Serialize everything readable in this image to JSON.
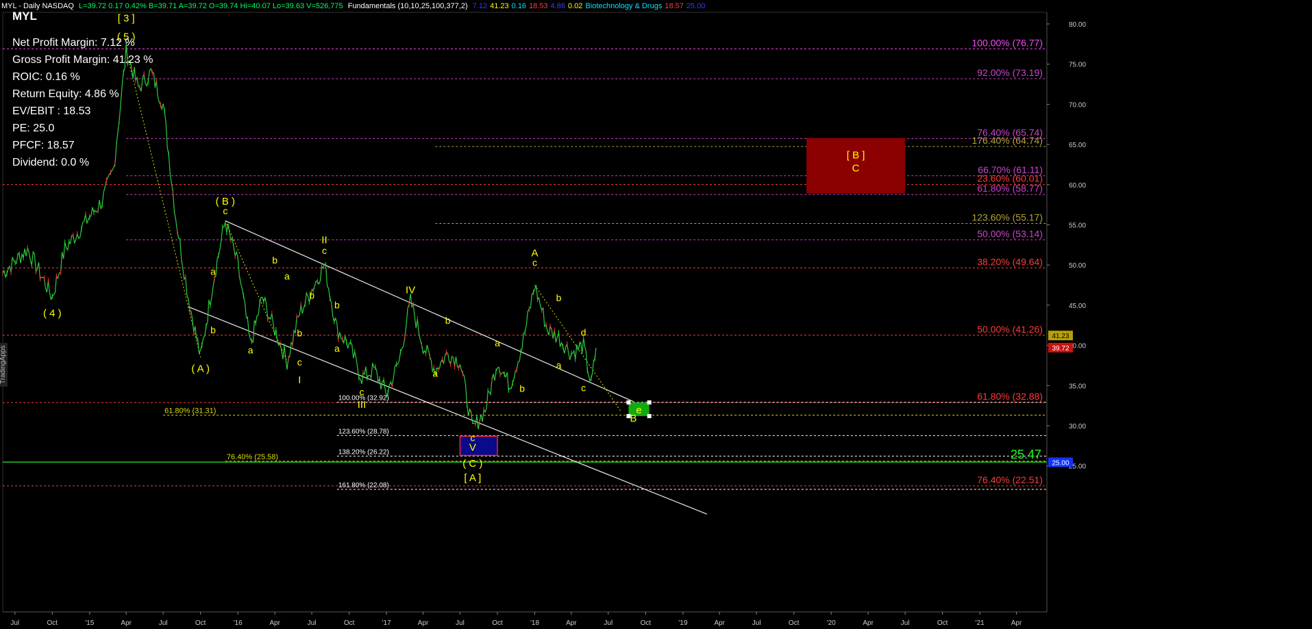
{
  "header": {
    "title": "MYL - Daily NASDAQ",
    "stats": "L=39.72  0.17  0.42%  B=39.71  A=39.72  O=39.74  Hi=40.07  Lo=39.63  V=526,775",
    "indicator": "Fundamentals (10,10,25,100,377,2)",
    "ind_values": [
      {
        "text": "7.12",
        "color": "#3a3aff"
      },
      {
        "text": "41.23",
        "color": "#ffff00"
      },
      {
        "text": "0.16",
        "color": "#00e5ff"
      },
      {
        "text": "18.53",
        "color": "#ff3b3b"
      },
      {
        "text": "4.86",
        "color": "#3a3aff"
      },
      {
        "text": "0.02",
        "color": "#ffff00"
      },
      {
        "text": "Biotechnology & Drugs",
        "color": "#00e5ff"
      },
      {
        "text": "18.57",
        "color": "#ff3b3b"
      },
      {
        "text": "25.00",
        "color": "#3a3aff"
      }
    ]
  },
  "ticker": "MYL",
  "fundamentals": [
    "Net Profit Margin: 7.12 %",
    "Gross Profit Margin: 41.23 %",
    "ROIC: 0.16 %",
    "Return Equity: 4.86 %",
    "EV/EBIT : 18.53",
    "PE: 25.0",
    "PFCF: 18.57",
    "Dividend: 0.0 %"
  ],
  "side_tag": "TradingApps",
  "chart_data": {
    "type": "line",
    "title": "MYL - Daily",
    "ylim": [
      19,
      82
    ],
    "y_ticks": [
      25,
      30,
      35,
      40,
      45,
      50,
      55,
      60,
      65,
      70,
      75,
      80
    ],
    "x_labels": [
      "Jul",
      "Oct",
      "'15",
      "Apr",
      "Jul",
      "Oct",
      "'16",
      "Apr",
      "Jul",
      "Oct",
      "'17",
      "Apr",
      "Jul",
      "Oct",
      "'18",
      "Apr",
      "Jul",
      "Oct",
      "'19",
      "Apr",
      "Jul",
      "Oct",
      "'20",
      "Apr",
      "Jul",
      "Oct",
      "'21",
      "Apr"
    ],
    "price_path": [
      {
        "date": "2014-06",
        "price": 49
      },
      {
        "date": "2014-08",
        "price": 52
      },
      {
        "date": "2014-09",
        "price": 49
      },
      {
        "date": "2014-10",
        "price": 46
      },
      {
        "date": "2014-11",
        "price": 52
      },
      {
        "date": "2015-01",
        "price": 56
      },
      {
        "date": "2015-02",
        "price": 58
      },
      {
        "date": "2015-03",
        "price": 62
      },
      {
        "date": "2015-04",
        "price": 76.7
      },
      {
        "date": "2015-05",
        "price": 72
      },
      {
        "date": "2015-06",
        "price": 74
      },
      {
        "date": "2015-07",
        "price": 70
      },
      {
        "date": "2015-08",
        "price": 56
      },
      {
        "date": "2015-09",
        "price": 46
      },
      {
        "date": "2015-10",
        "price": 38.5
      },
      {
        "date": "2015-11",
        "price": 48
      },
      {
        "date": "2015-12",
        "price": 55.5
      },
      {
        "date": "2016-01",
        "price": 50
      },
      {
        "date": "2016-02",
        "price": 40
      },
      {
        "date": "2016-03",
        "price": 46
      },
      {
        "date": "2016-05",
        "price": 38
      },
      {
        "date": "2016-06",
        "price": 44
      },
      {
        "date": "2016-08",
        "price": 50
      },
      {
        "date": "2016-09",
        "price": 42
      },
      {
        "date": "2016-10",
        "price": 40
      },
      {
        "date": "2016-11",
        "price": 36
      },
      {
        "date": "2016-12",
        "price": 37
      },
      {
        "date": "2017-01",
        "price": 34
      },
      {
        "date": "2017-02",
        "price": 38
      },
      {
        "date": "2017-03",
        "price": 45.5
      },
      {
        "date": "2017-04",
        "price": 40
      },
      {
        "date": "2017-05",
        "price": 37
      },
      {
        "date": "2017-06",
        "price": 39
      },
      {
        "date": "2017-07",
        "price": 38
      },
      {
        "date": "2017-08",
        "price": 29.5
      },
      {
        "date": "2017-09",
        "price": 32
      },
      {
        "date": "2017-10",
        "price": 38
      },
      {
        "date": "2017-11",
        "price": 35
      },
      {
        "date": "2017-12",
        "price": 40
      },
      {
        "date": "2018-01",
        "price": 47.5
      },
      {
        "date": "2018-02",
        "price": 42
      },
      {
        "date": "2018-03",
        "price": 41
      },
      {
        "date": "2018-04",
        "price": 39
      },
      {
        "date": "2018-05",
        "price": 40
      },
      {
        "date": "2018-05-20",
        "price": 35
      },
      {
        "date": "2018-06",
        "price": 39.7
      }
    ],
    "price_levels": [
      {
        "label": "100.00% (76.77)",
        "value": 76.9,
        "color": "#ff44ff",
        "style": "dash",
        "from": "2014-06"
      },
      {
        "label": "92.00% (73.19)",
        "value": 73.19,
        "color": "#cc44cc",
        "style": "dash",
        "from": "2015-04"
      },
      {
        "label": "76.40% (65.74)",
        "value": 65.74,
        "color": "#cc44cc",
        "style": "dash",
        "from": "2015-04"
      },
      {
        "label": "176.40% (64.74)",
        "value": 64.74,
        "color": "#b5a43a",
        "style": "dash",
        "from": "2017-05"
      },
      {
        "label": "66.70% (61.11)",
        "value": 61.11,
        "color": "#cc44cc",
        "style": "dash",
        "from": "2015-04"
      },
      {
        "label": "23.60% (60.01)",
        "value": 60.01,
        "color": "#ff3b3b",
        "style": "dash",
        "from": "2014-06"
      },
      {
        "label": "61.80% (58.77)",
        "value": 58.77,
        "color": "#cc44cc",
        "style": "dash",
        "from": "2015-04"
      },
      {
        "label": "123.60% (55.17)",
        "value": 55.17,
        "color": "#b5a43a",
        "style": "dash",
        "from": "2017-05"
      },
      {
        "label": "50.00% (53.14)",
        "value": 53.14,
        "color": "#cc44cc",
        "style": "dash",
        "from": "2015-04"
      },
      {
        "label": "38.20% (49.64)",
        "value": 49.64,
        "color": "#ff3b3b",
        "style": "dash",
        "from": "2014-06"
      },
      {
        "label": "50.00% (41.26)",
        "value": 41.26,
        "color": "#ff3b3b",
        "style": "dash",
        "from": "2014-06"
      },
      {
        "label": "61.80% (32.88)",
        "value": 32.88,
        "color": "#ff3b3b",
        "style": "dash",
        "from": "2014-06"
      },
      {
        "label": "76.40% (22.51)",
        "value": 22.51,
        "color": "#ff3b3b",
        "style": "dash",
        "from": "2014-06"
      }
    ],
    "fib_left_levels": [
      {
        "label": "100.00% (32.92)",
        "value": 32.92,
        "color": "#ffffff",
        "from": "2016-09"
      },
      {
        "label": "61.80% (31.31)",
        "value": 31.31,
        "color": "#dddd00",
        "from": "2015-07"
      },
      {
        "label": "123.60% (28.78)",
        "value": 28.78,
        "color": "#ffffff",
        "from": "2016-09"
      },
      {
        "label": "138.20% (26.22)",
        "value": 26.22,
        "color": "#ffffff",
        "from": "2016-09"
      },
      {
        "label": "76.40% (25.58)",
        "value": 25.58,
        "color": "#dddd00",
        "from": "2015-12"
      },
      {
        "label": "161.80% (22.08)",
        "value": 22.08,
        "color": "#ffffff",
        "from": "2016-09"
      }
    ],
    "green_line": {
      "label": "25.47",
      "value": 25.47
    },
    "price_boxes": [
      {
        "label": "41.23",
        "value": 41.23,
        "bg": "#b8a000",
        "fg": "#000"
      },
      {
        "label": "39.72",
        "value": 39.72,
        "bg": "#cc1111",
        "fg": "#fff"
      },
      {
        "label": "25.00",
        "value": 25.45,
        "bg": "#1133ff",
        "fg": "#fff"
      }
    ],
    "zones": [
      {
        "name": "wave-b-target",
        "x0": "2019-11",
        "x1": "2020-07",
        "y0": 58.9,
        "y1": 65.8,
        "fill": "#8b0000",
        "labels": [
          "[ B ]",
          "C"
        ]
      },
      {
        "name": "wave-c-bottom",
        "x0": "2017-07",
        "x1": "2017-10",
        "y0": 26.3,
        "y1": 28.7,
        "fill": "#0a0a8c",
        "labels": []
      },
      {
        "name": "wave-b-green",
        "x0": "2018-08-20",
        "x1": "2018-10-10",
        "y0": 31.2,
        "y1": 32.9,
        "fill": "#11aa11",
        "labels": [
          "e"
        ]
      }
    ],
    "channel_lines": [
      {
        "from": [
          "2015-12",
          "55.5"
        ],
        "to": [
          "2018-09",
          "33"
        ]
      },
      {
        "from": [
          "2015-09",
          "44.8"
        ],
        "to": [
          "2019-03",
          "19"
        ]
      }
    ],
    "dotted_lines": [
      {
        "from": [
          "2015-04",
          "76.7"
        ],
        "to": [
          "2015-10",
          "38.5"
        ]
      },
      {
        "from": [
          "2015-12",
          "55.5"
        ],
        "to": [
          "2016-05",
          "38"
        ]
      },
      {
        "from": [
          "2018-01",
          "47.5"
        ],
        "to": [
          "2018-08",
          "31.8"
        ]
      }
    ],
    "wave_labels": [
      {
        "t": "[ 3 ]",
        "x": "2015-04",
        "y": 80.3
      },
      {
        "t": "( 5 )",
        "x": "2015-04",
        "y": 78
      },
      {
        "t": "( 4 )",
        "x": "2014-10",
        "y": 43.6
      },
      {
        "t": "( B )",
        "x": "2015-12",
        "y": 57.5
      },
      {
        "t": "c",
        "x": "2015-12",
        "y": 56.3
      },
      {
        "t": "( A )",
        "x": "2015-10",
        "y": 36.7
      },
      {
        "t": "a",
        "x": "2015-11",
        "y": 48.8
      },
      {
        "t": "b",
        "x": "2015-11",
        "y": 41.5
      },
      {
        "t": "a",
        "x": "2016-02",
        "y": 39
      },
      {
        "t": "b",
        "x": "2016-04",
        "y": 50.2
      },
      {
        "t": "a",
        "x": "2016-05",
        "y": 48.2
      },
      {
        "t": "c",
        "x": "2016-06",
        "y": 37.5
      },
      {
        "t": "I",
        "x": "2016-06",
        "y": 35.3
      },
      {
        "t": "b",
        "x": "2016-06",
        "y": 41.1
      },
      {
        "t": "b",
        "x": "2016-07",
        "y": 45.8
      },
      {
        "t": "II",
        "x": "2016-08",
        "y": 52.7
      },
      {
        "t": "c",
        "x": "2016-08",
        "y": 51.4
      },
      {
        "t": "b",
        "x": "2016-09",
        "y": 44.6
      },
      {
        "t": "a",
        "x": "2016-09",
        "y": 39.2
      },
      {
        "t": "c",
        "x": "2016-11",
        "y": 33.8
      },
      {
        "t": "III",
        "x": "2016-11",
        "y": 32.2
      },
      {
        "t": "IV",
        "x": "2017-03",
        "y": 46.5
      },
      {
        "t": "a",
        "x": "2017-05",
        "y": 36.1
      },
      {
        "t": "b",
        "x": "2017-06",
        "y": 42.7
      },
      {
        "t": "c",
        "x": "2017-08",
        "y": 28.1
      },
      {
        "t": "V",
        "x": "2017-08",
        "y": 26.9
      },
      {
        "t": "( C )",
        "x": "2017-08",
        "y": 24.9
      },
      {
        "t": "[ A ]",
        "x": "2017-08",
        "y": 23.1
      },
      {
        "t": "a",
        "x": "2017-10",
        "y": 39.9
      },
      {
        "t": "b",
        "x": "2017-12",
        "y": 34.2
      },
      {
        "t": "A",
        "x": "2018-01",
        "y": 51.1
      },
      {
        "t": "c",
        "x": "2018-01",
        "y": 49.9
      },
      {
        "t": "b",
        "x": "2018-03",
        "y": 45.5
      },
      {
        "t": "a",
        "x": "2018-03",
        "y": 37.1
      },
      {
        "t": "d",
        "x": "2018-05",
        "y": 41.2
      },
      {
        "t": "c",
        "x": "2018-05",
        "y": 34.3
      },
      {
        "t": "B",
        "x": "2018-09",
        "y": 30.5
      }
    ]
  }
}
